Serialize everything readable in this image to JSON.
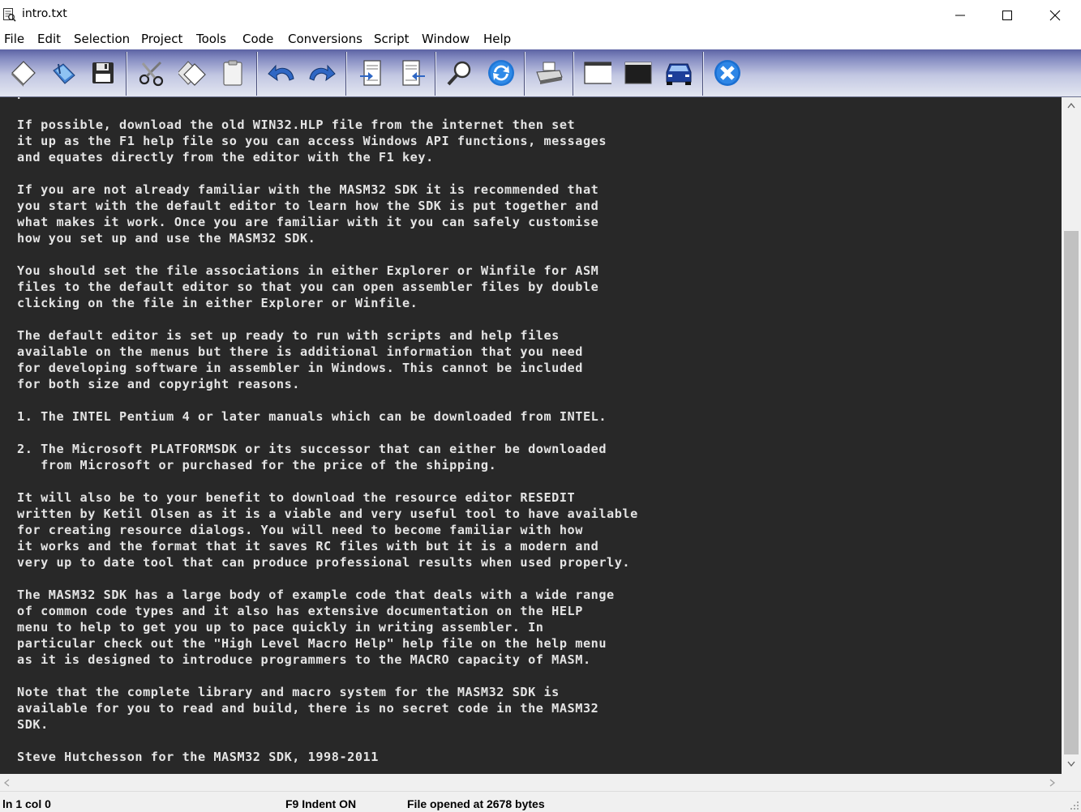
{
  "window": {
    "title": "intro.txt"
  },
  "menu": {
    "items": [
      "File",
      "Edit",
      "Selection",
      "Project",
      "Tools",
      "Code",
      "Conversions",
      "Script",
      "Window",
      "Help"
    ]
  },
  "toolbar": {
    "buttons": [
      {
        "name": "new-file",
        "icon": "new-document-icon"
      },
      {
        "name": "open-file",
        "icon": "open-book-icon"
      },
      {
        "name": "save-file",
        "icon": "floppy-disk-icon"
      },
      {
        "name": "cut",
        "icon": "scissors-icon"
      },
      {
        "name": "copy",
        "icon": "copy-icon"
      },
      {
        "name": "paste",
        "icon": "clipboard-icon"
      },
      {
        "name": "undo",
        "icon": "undo-arrow-icon"
      },
      {
        "name": "redo",
        "icon": "redo-arrow-icon"
      },
      {
        "name": "indent",
        "icon": "indent-icon"
      },
      {
        "name": "outdent",
        "icon": "outdent-icon"
      },
      {
        "name": "find",
        "icon": "magnifier-icon"
      },
      {
        "name": "replace",
        "icon": "refresh-icon"
      },
      {
        "name": "print",
        "icon": "printer-icon"
      },
      {
        "name": "new-window",
        "icon": "white-window-icon"
      },
      {
        "name": "console",
        "icon": "black-window-icon"
      },
      {
        "name": "run",
        "icon": "car-icon"
      },
      {
        "name": "exit",
        "icon": "close-circle-icon"
      }
    ]
  },
  "editor": {
    "lines": [
      "preferences.",
      "",
      "If possible, download the old WIN32.HLP file from the internet then set",
      "it up as the F1 help file so you can access Windows API functions, messages",
      "and equates directly from the editor with the F1 key.",
      "",
      "If you are not already familiar with the MASM32 SDK it is recommended that",
      "you start with the default editor to learn how the SDK is put together and",
      "what makes it work. Once you are familiar with it you can safely customise",
      "how you set up and use the MASM32 SDK.",
      "",
      "You should set the file associations in either Explorer or Winfile for ASM",
      "files to the default editor so that you can open assembler files by double",
      "clicking on the file in either Explorer or Winfile.",
      "",
      "The default editor is set up ready to run with scripts and help files",
      "available on the menus but there is additional information that you need",
      "for developing software in assembler in Windows. This cannot be included",
      "for both size and copyright reasons.",
      "",
      "1. The INTEL Pentium 4 or later manuals which can be downloaded from INTEL.",
      "",
      "2. The Microsoft PLATFORMSDK or its successor that can either be downloaded",
      "   from Microsoft or purchased for the price of the shipping.",
      "",
      "It will also be to your benefit to download the resource editor RESEDIT",
      "written by Ketil Olsen as it is a viable and very useful tool to have available",
      "for creating resource dialogs. You will need to become familiar with how",
      "it works and the format that it saves RC files with but it is a modern and",
      "very up to date tool that can produce professional results when used properly.",
      "",
      "The MASM32 SDK has a large body of example code that deals with a wide range",
      "of common code types and it also has extensive documentation on the HELP",
      "menu to help to get you up to pace quickly in writing assembler. In",
      "particular check out the \"High Level Macro Help\" help file on the help menu",
      "as it is designed to introduce programmers to the MACRO capacity of MASM.",
      "",
      "Note that the complete library and macro system for the MASM32 SDK is",
      "available for you to read and build, there is no secret code in the MASM32",
      "SDK.",
      "",
      "Steve Hutchesson for the MASM32 SDK, 1998-2011"
    ]
  },
  "status": {
    "position": "ln 1 col 0",
    "indent": "F9 Indent ON",
    "message": "File opened at 2678 bytes"
  },
  "colors": {
    "editor_background": "#282828",
    "editor_text": "#e4e4e4",
    "toolbar_gradient_top": "#5c63a4",
    "toolbar_gradient_bottom": "#e3e6f1"
  }
}
